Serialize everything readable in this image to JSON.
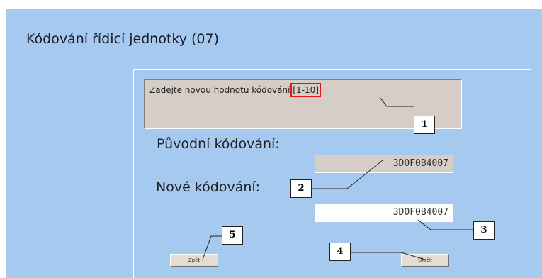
{
  "dialog": {
    "title": "Kódování řídicí jednotky (07)",
    "message_prefix": "Zadejte novou hodnotu kódování ",
    "message_range": "[1-10]",
    "message_suffix": ":"
  },
  "fields": {
    "original_label": "Původní kódování:",
    "original_value": "3D0F0B4007",
    "new_label": "Nové kódování:",
    "new_value": "3D0F0B4007"
  },
  "buttons": {
    "back_label": "Zpět",
    "save_label": "Uložit"
  },
  "callouts": [
    "1",
    "2",
    "3",
    "4",
    "5"
  ],
  "colors": {
    "window_bg": "#a6c9ef",
    "readonly_bg": "#d6cec6",
    "highlight": "#e31515"
  }
}
